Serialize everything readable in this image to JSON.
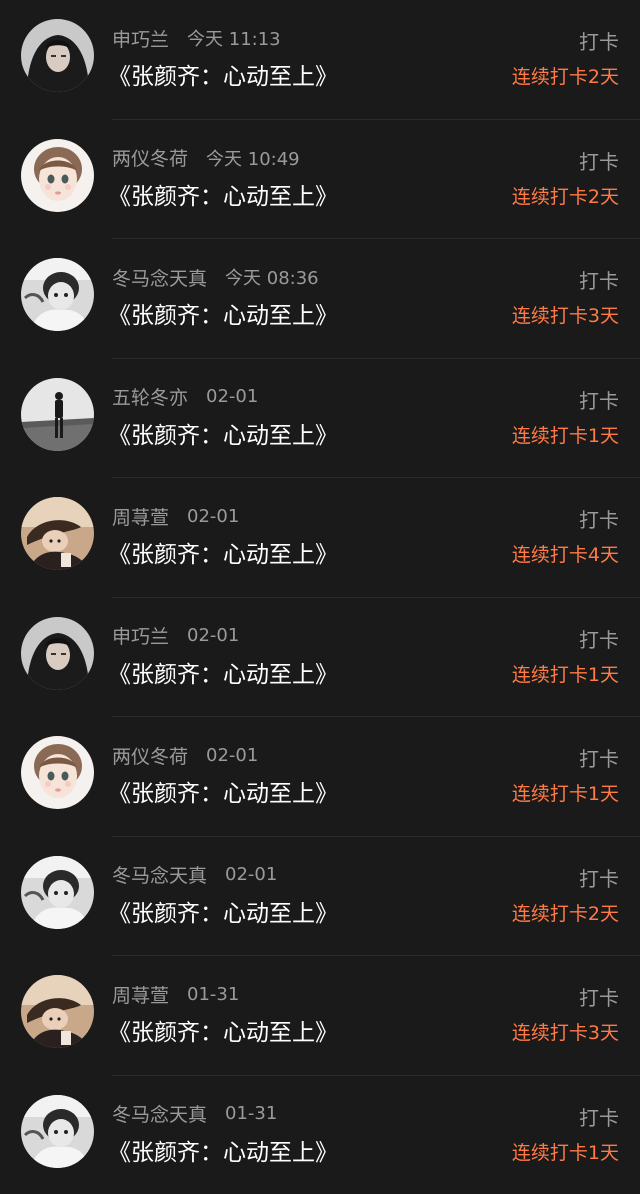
{
  "colors": {
    "background": "#1a1a1a",
    "name_text": "#9a9a9a",
    "title_text": "#ffffff",
    "streak_text": "#ff7a45"
  },
  "entries": [
    {
      "user": "申巧兰",
      "time": "今天 11:13",
      "book": "《张颜齐：心动至上》",
      "action": "打卡",
      "streak": "连续打卡2天",
      "avatar": "hooded-person"
    },
    {
      "user": "两仪冬荷",
      "time": "今天 10:49",
      "book": "《张颜齐：心动至上》",
      "action": "打卡",
      "streak": "连续打卡2天",
      "avatar": "cartoon-girl"
    },
    {
      "user": "冬马念天真",
      "time": "今天 08:36",
      "book": "《张颜齐：心动至上》",
      "action": "打卡",
      "streak": "连续打卡3天",
      "avatar": "grayscale-girl"
    },
    {
      "user": "五轮冬亦",
      "time": "02-01",
      "book": "《张颜齐：心动至上》",
      "action": "打卡",
      "streak": "连续打卡1天",
      "avatar": "standing-figure"
    },
    {
      "user": "周荨萱",
      "time": "02-01",
      "book": "《张颜齐：心动至上》",
      "action": "打卡",
      "streak": "连续打卡4天",
      "avatar": "reclining-person"
    },
    {
      "user": "申巧兰",
      "time": "02-01",
      "book": "《张颜齐：心动至上》",
      "action": "打卡",
      "streak": "连续打卡1天",
      "avatar": "hooded-person"
    },
    {
      "user": "两仪冬荷",
      "time": "02-01",
      "book": "《张颜齐：心动至上》",
      "action": "打卡",
      "streak": "连续打卡1天",
      "avatar": "cartoon-girl"
    },
    {
      "user": "冬马念天真",
      "time": "02-01",
      "book": "《张颜齐：心动至上》",
      "action": "打卡",
      "streak": "连续打卡2天",
      "avatar": "grayscale-girl"
    },
    {
      "user": "周荨萱",
      "time": "01-31",
      "book": "《张颜齐：心动至上》",
      "action": "打卡",
      "streak": "连续打卡3天",
      "avatar": "reclining-person"
    },
    {
      "user": "冬马念天真",
      "time": "01-31",
      "book": "《张颜齐：心动至上》",
      "action": "打卡",
      "streak": "连续打卡1天",
      "avatar": "grayscale-girl"
    }
  ]
}
